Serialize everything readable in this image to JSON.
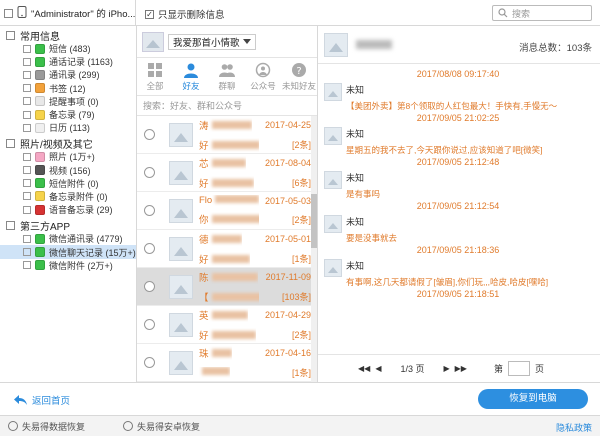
{
  "device": {
    "name": "\"Administrator\" 的 iPho..."
  },
  "toolbar": {
    "only_deleted_label": "只显示删除信息",
    "search_placeholder": "搜索"
  },
  "categories": [
    {
      "group": "常用信息",
      "items": [
        {
          "label": "短信 (483)",
          "color": "#3bbf4a"
        },
        {
          "label": "通话记录 (1163)",
          "color": "#3bbf4a"
        },
        {
          "label": "通讯录 (299)",
          "color": "#9a9a9a"
        },
        {
          "label": "书签 (12)",
          "color": "#f3a23b"
        },
        {
          "label": "提醒事项 (0)",
          "color": "#e8e8e8"
        },
        {
          "label": "备忘录 (79)",
          "color": "#f6d34a"
        },
        {
          "label": "日历 (113)",
          "color": "#f0f0f0"
        }
      ]
    },
    {
      "group": "照片/视频及其它",
      "items": [
        {
          "label": "照片 (1万+)",
          "color": "#f5a7c4"
        },
        {
          "label": "视频 (156)",
          "color": "#555555"
        },
        {
          "label": "短信附件 (0)",
          "color": "#3bbf4a"
        },
        {
          "label": "备忘录附件 (0)",
          "color": "#f6d34a"
        },
        {
          "label": "语音备忘录 (29)",
          "color": "#d63333"
        }
      ]
    },
    {
      "group": "第三方APP",
      "items": [
        {
          "label": "微信通讯录 (4779)",
          "color": "#3bbf4a"
        },
        {
          "label": "微信聊天记录 (15万+)",
          "color": "#3bbf4a",
          "selected": true
        },
        {
          "label": "微信附件 (2万+)",
          "color": "#3bbf4a"
        }
      ]
    }
  ],
  "contact": {
    "name": "我爱那首小情歌"
  },
  "tabs": [
    {
      "label": "全部",
      "icon": "grid-icon"
    },
    {
      "label": "好友",
      "icon": "person-icon",
      "active": true
    },
    {
      "label": "群聊",
      "icon": "group-icon"
    },
    {
      "label": "公众号",
      "icon": "official-account-icon"
    },
    {
      "label": "未知好友",
      "icon": "unknown-friend-icon"
    }
  ],
  "filter_placeholder": "搜索：好友、群和公众号",
  "conversations": [
    {
      "name": "涛",
      "preview": "好",
      "date": "2017-04-25",
      "count": "[2条]"
    },
    {
      "name": "芯",
      "preview": "好",
      "date": "2017-08-04",
      "count": "[6条]"
    },
    {
      "name": "Flo",
      "preview": "你",
      "date": "2017-05-03",
      "count": "[2条]"
    },
    {
      "name": "德",
      "preview": "好",
      "date": "2017-05-01",
      "count": "[1条]"
    },
    {
      "name": "陈",
      "preview": "【",
      "date": "2017-11-09",
      "count": "[103条]",
      "selected": true
    },
    {
      "name": "英",
      "preview": "好",
      "date": "2017-04-29",
      "count": "[2条]"
    },
    {
      "name": "珠",
      "preview": "",
      "date": "2017-04-16",
      "count": "[1条]"
    },
    {
      "name": "谢",
      "preview": "",
      "date": "2017-05-02",
      "count": ""
    }
  ],
  "chat": {
    "total_label": "消息总数：103条",
    "messages": [
      {
        "time": "2017/08/08 09:17:40",
        "sender": "未知",
        "text": "【美团外卖】第8个领取的人红包最大！手快有,手慢无～"
      },
      {
        "time": "2017/09/05 21:02:25",
        "sender": "未知",
        "text": "星期五的我不去了,今天跟你说过,应该知道了吧[微笑]"
      },
      {
        "time": "2017/09/05 21:12:48",
        "sender": "未知",
        "text": "是有事吗"
      },
      {
        "time": "2017/09/05 21:12:54",
        "sender": "未知",
        "text": "要是没事就去"
      },
      {
        "time": "2017/09/05 21:18:36",
        "sender": "未知",
        "text": "有事啊,这几天都请假了[皱眉],你们玩,,,哈皮,哈皮[嘿哈]"
      },
      {
        "time": "2017/09/05 21:18:51",
        "sender": "",
        "text": ""
      }
    ]
  },
  "pager": {
    "current": "1/3 页",
    "goto_label": "第",
    "page_unit": "页"
  },
  "bottom": {
    "back_label": "返回首页",
    "recover_label": "恢复到电脑"
  },
  "status": {
    "item1": "失易得数据恢复",
    "item2": "失易得安卓恢复",
    "privacy": "隐私政策"
  }
}
